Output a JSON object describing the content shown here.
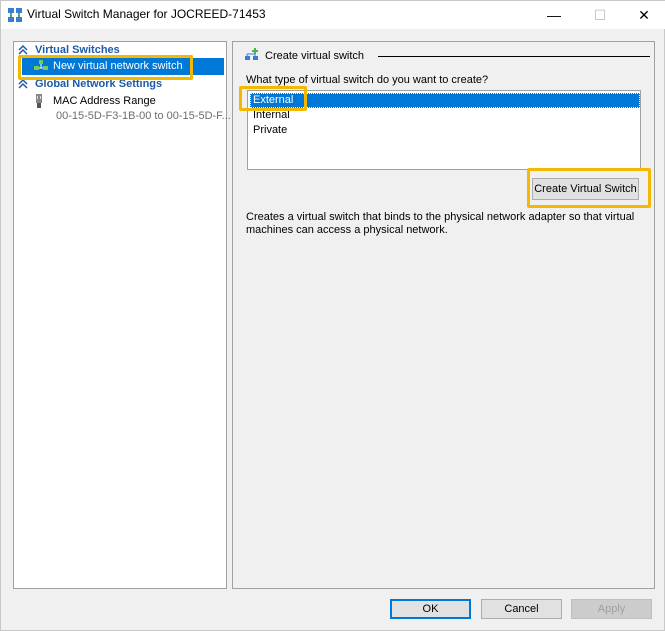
{
  "window": {
    "title": "Virtual Switch Manager for JOCREED-71453",
    "controls": {
      "minimize": "—",
      "maximize": "☐",
      "close": "✕"
    }
  },
  "left_panel": {
    "virtual_switches_header": "Virtual Switches",
    "new_switch_label": "New virtual network switch",
    "global_settings_header": "Global Network Settings",
    "mac_range_label": "MAC Address Range",
    "mac_range_value": "00-15-5D-F3-1B-00 to 00-15-5D-F..."
  },
  "right_panel": {
    "header": "Create virtual switch",
    "question": "What type of virtual switch do you want to create?",
    "switch_types": [
      "External",
      "Internal",
      "Private"
    ],
    "selected_type": "External",
    "create_button": "Create Virtual Switch",
    "description": "Creates a virtual switch that binds to the physical network adapter so that virtual machines can access a physical network."
  },
  "footer": {
    "ok": "OK",
    "cancel": "Cancel",
    "apply": "Apply"
  },
  "colors": {
    "selection": "#0078d7",
    "section_header": "#1e5aa6",
    "callout": "#f5b800"
  }
}
